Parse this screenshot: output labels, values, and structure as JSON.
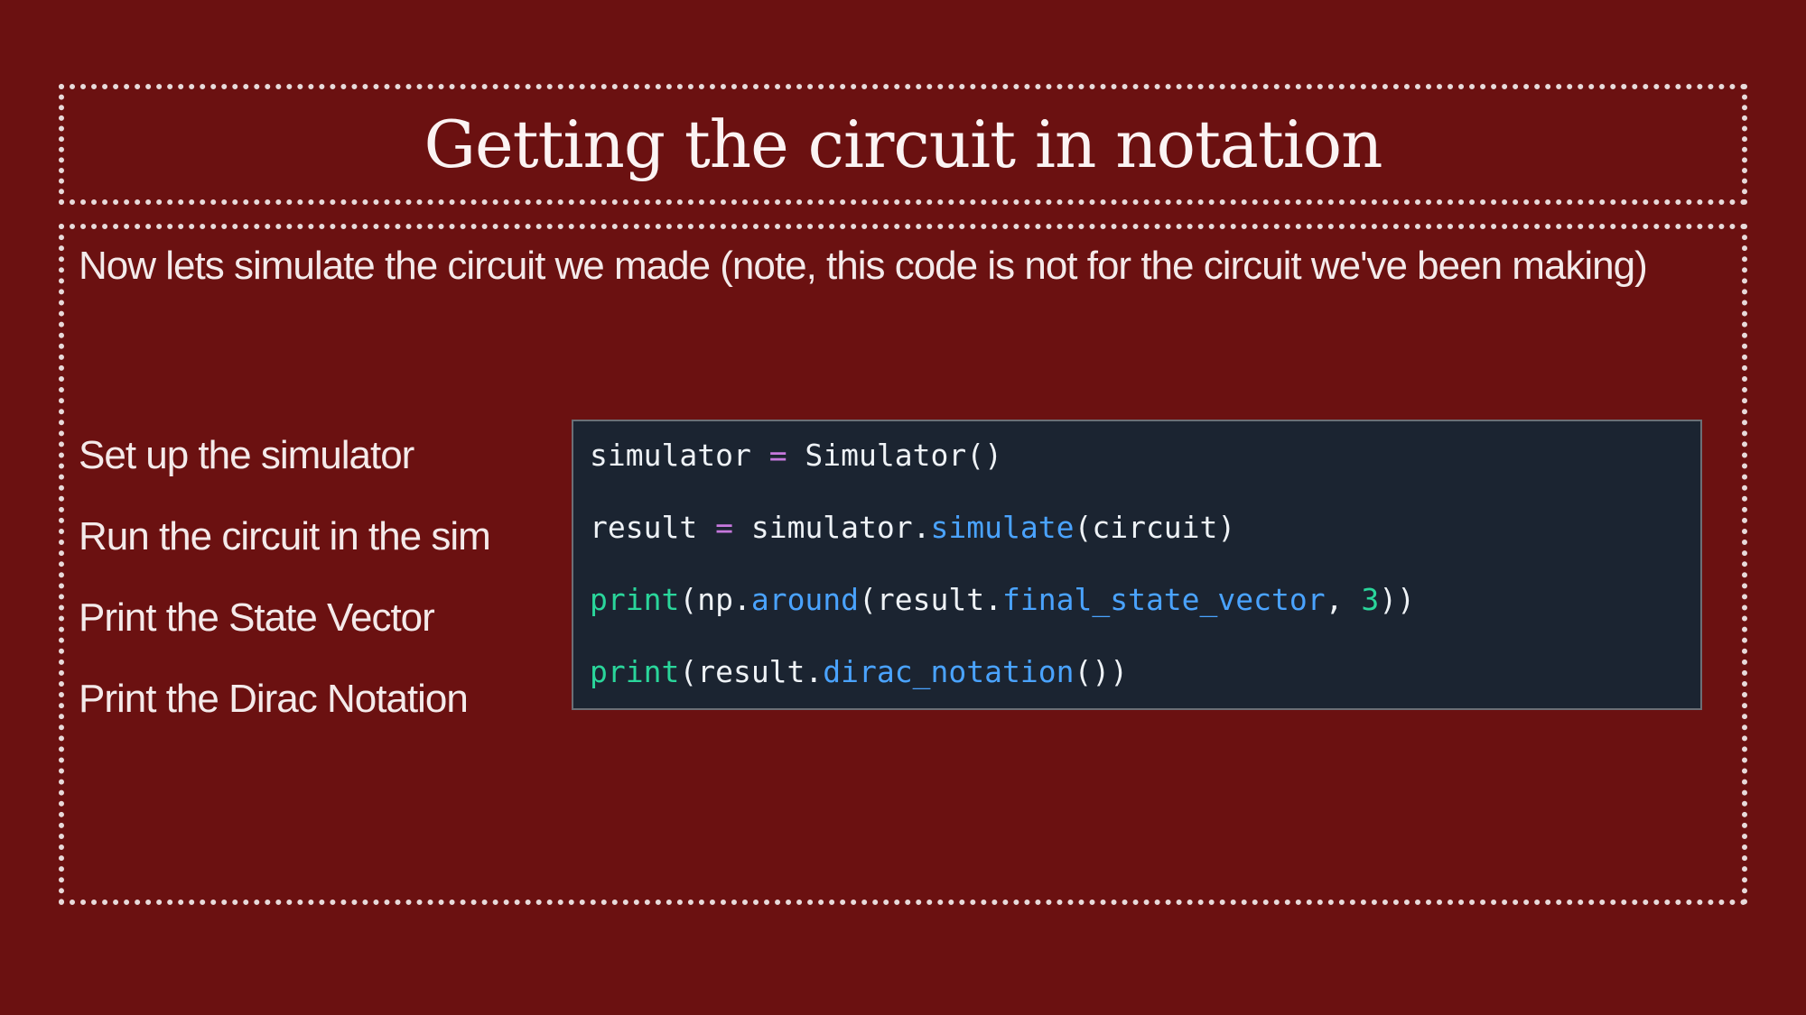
{
  "slide": {
    "title": "Getting the circuit in notation",
    "intro": "Now lets simulate the circuit we made (note, this code is not for the circuit we've been making)",
    "steps": [
      "Set up the simulator",
      "Run the circuit in the sim",
      "Print the State Vector",
      "Print the Dirac Notation"
    ]
  },
  "code": {
    "line1": {
      "t1": "simulator",
      "t2": " ",
      "t3": "=",
      "t4": " Simulator()"
    },
    "line2": {
      "t1": "result",
      "t2": " ",
      "t3": "=",
      "t4": " simulator.",
      "t5": "simulate",
      "t6": "(circuit)"
    },
    "line3": {
      "t1": "print",
      "t2": "(np.",
      "t3": "around",
      "t4": "(result.",
      "t5": "final_state_vector",
      "t6": ", ",
      "t7": "3",
      "t8": "))"
    },
    "line4": {
      "t1": "print",
      "t2": "(result.",
      "t3": "dirac_notation",
      "t4": "())"
    }
  },
  "colors": {
    "background": "#6b1111",
    "border": "#e8dada",
    "code_background": "#1b2431",
    "code_default": "#eef2f6",
    "code_operator": "#c678dd",
    "code_function": "#4aa3ff",
    "code_keyword": "#2ad69b"
  }
}
